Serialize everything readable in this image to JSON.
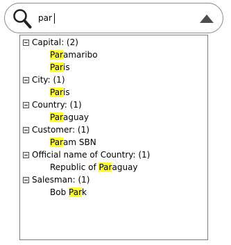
{
  "search": {
    "value": "par",
    "icon": "search-icon",
    "toggle_icon": "chevron-up-icon"
  },
  "results": {
    "highlight_color": "#ffff33",
    "groups": [
      {
        "label": "Capital: (2)",
        "items": [
          {
            "before": "",
            "match": "Par",
            "after": "amaribo"
          },
          {
            "before": "",
            "match": "Par",
            "after": "is"
          }
        ]
      },
      {
        "label": "City: (1)",
        "items": [
          {
            "before": "",
            "match": "Par",
            "after": "is"
          }
        ]
      },
      {
        "label": "Country: (1)",
        "items": [
          {
            "before": "",
            "match": "Par",
            "after": "aguay"
          }
        ]
      },
      {
        "label": "Customer: (1)",
        "items": [
          {
            "before": "",
            "match": "Par",
            "after": "am SBN"
          }
        ]
      },
      {
        "label": "Official name of Country: (1)",
        "items": [
          {
            "before": "Republic of ",
            "match": "Par",
            "after": "aguay"
          }
        ]
      },
      {
        "label": "Salesman: (1)",
        "items": [
          {
            "before": "Bob ",
            "match": "Par",
            "after": "k"
          }
        ]
      }
    ]
  }
}
